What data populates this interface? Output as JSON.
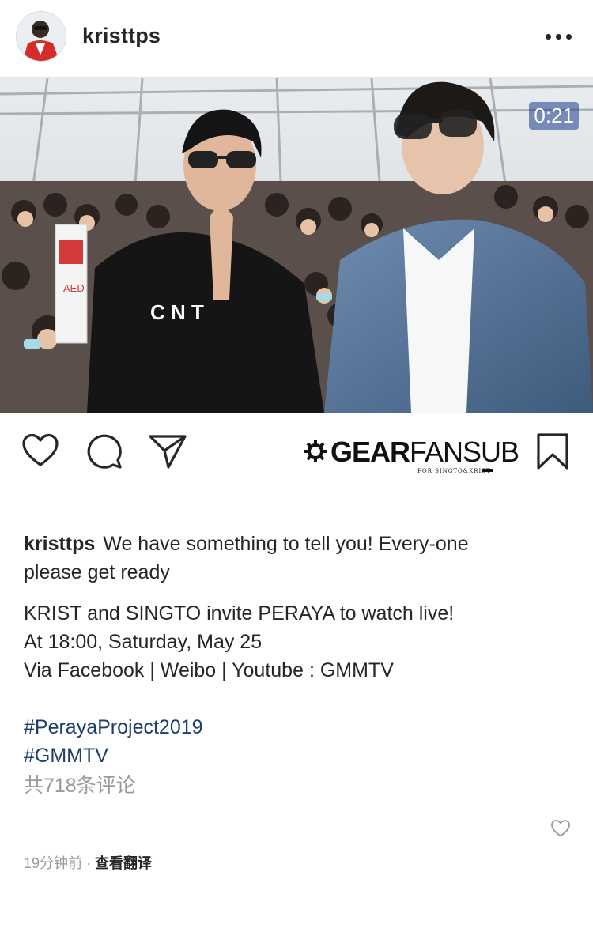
{
  "header": {
    "username": "kristtps",
    "icons": {
      "more": "more-horizontal-icon"
    }
  },
  "media": {
    "timer": "0:21"
  },
  "actions": {
    "icons": [
      "heart-icon",
      "comment-icon",
      "share-icon",
      "bookmark-icon"
    ],
    "watermark": {
      "bold": "GEAR",
      "light": "FANSUB",
      "sub": "FOR SINGTO&KRIST"
    }
  },
  "caption": {
    "username": "kristtps",
    "line1": "We have something to tell you! Every-one please get ready",
    "line2": "KRIST and SINGTO invite PERAYA to watch live!",
    "line3": "At 18:00, Saturday, May 25",
    "line4": "Via  Facebook | Weibo | Youtube : GMMTV",
    "hashtags": [
      "#PerayaProject2019",
      "#GMMTV"
    ],
    "comments": "共718条评论"
  },
  "footer": {
    "time": "19分钟前",
    "separator": " · ",
    "translate": "查看翻译"
  },
  "colors": {
    "hashtag": "#1f3e6e",
    "muted": "#9a9a9a",
    "text": "#262626"
  }
}
